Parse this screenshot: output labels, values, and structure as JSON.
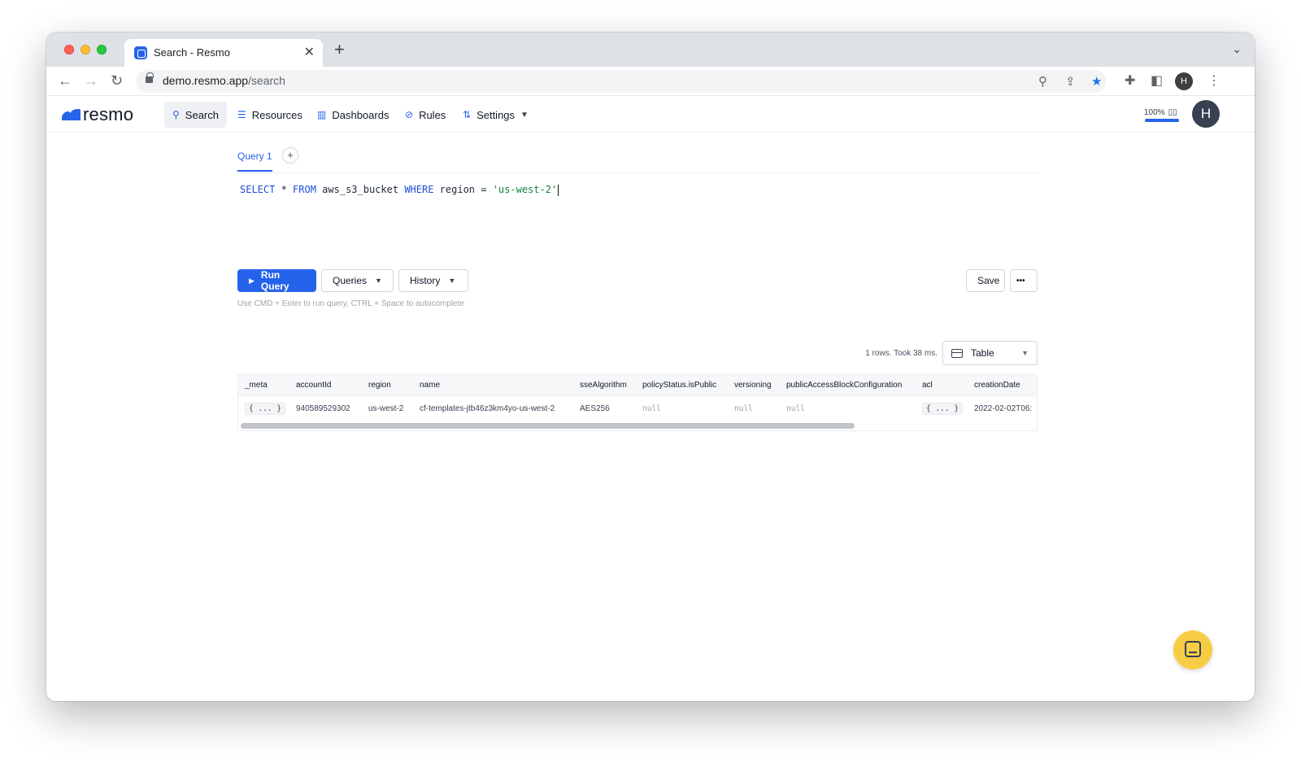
{
  "browser": {
    "tab_title": "Search - Resmo",
    "new_tab": "+",
    "tab_close": "✕",
    "url_host": "demo.resmo.app",
    "url_path": "/search",
    "profile_initial": "H"
  },
  "app": {
    "logo_text": "resmo",
    "nav": [
      {
        "label": "Search",
        "icon": "search-icon",
        "active": true
      },
      {
        "label": "Resources",
        "icon": "list-icon"
      },
      {
        "label": "Dashboards",
        "icon": "bar-chart-icon"
      },
      {
        "label": "Rules",
        "icon": "check-circle-icon"
      },
      {
        "label": "Settings",
        "icon": "sliders-icon",
        "dropdown": true
      }
    ],
    "zoom_label": "100%",
    "zoom_level_percent": 100,
    "user_initial": "H",
    "accent_color": "#2563eb"
  },
  "query": {
    "tab_label": "Query 1",
    "add_tab": "+",
    "sql": {
      "kw_select": "SELECT",
      "star": " * ",
      "kw_from": "FROM",
      "table": " aws_s3_bucket ",
      "kw_where": "WHERE",
      "condition": " region = ",
      "value": "'us-west-2'"
    },
    "run_label": "Run Query",
    "queries_label": "Queries",
    "history_label": "History",
    "save_label": "Save",
    "more_label": "•••",
    "hint": "Use CMD + Enter to run query, CTRL + Space to autocomplete"
  },
  "results": {
    "summary": "1 rows. Took 38 ms.",
    "view_label": "Table",
    "columns": [
      "_meta",
      "accountId",
      "region",
      "name",
      "sseAlgorithm",
      "policyStatus.isPublic",
      "versioning",
      "publicAccessBlockConfiguration",
      "acl",
      "creationDate"
    ],
    "rows": [
      [
        "{ ... }",
        "940589529302",
        "us-west-2",
        "cf-templates-jtb46z3km4yo-us-west-2",
        "AES256",
        "null",
        "null",
        "null",
        "{ ... }",
        "2022-02-02T06:"
      ]
    ]
  }
}
